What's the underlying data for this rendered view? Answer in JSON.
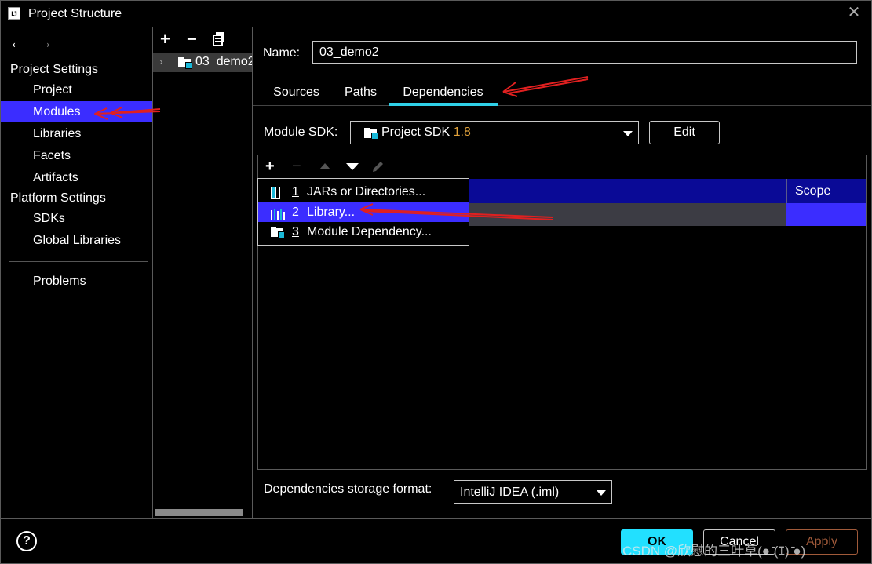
{
  "window": {
    "title": "Project Structure",
    "icon_text": "IJ"
  },
  "nav": {
    "back": "←",
    "forward": "→"
  },
  "sidebar": {
    "project_settings": "Project Settings",
    "items": [
      {
        "label": "Project"
      },
      {
        "label": "Modules"
      },
      {
        "label": "Libraries"
      },
      {
        "label": "Facets"
      },
      {
        "label": "Artifacts"
      }
    ],
    "platform_settings": "Platform Settings",
    "platform_items": [
      {
        "label": "SDKs"
      },
      {
        "label": "Global Libraries"
      }
    ],
    "problems": "Problems"
  },
  "tree": {
    "module": "03_demo2"
  },
  "name_field": {
    "label": "Name:",
    "value": "03_demo2"
  },
  "tabs": [
    {
      "label": "Sources"
    },
    {
      "label": "Paths"
    },
    {
      "label": "Dependencies"
    }
  ],
  "sdk": {
    "label": "Module SDK:",
    "value": "Project SDK",
    "version": "1.8",
    "edit": "Edit"
  },
  "dependencies": {
    "scope_header": "Scope"
  },
  "popup": [
    {
      "num": "1",
      "label": "JARs or Directories..."
    },
    {
      "num": "2",
      "label": "Library..."
    },
    {
      "num": "3",
      "label": "Module Dependency..."
    }
  ],
  "storage": {
    "label": "Dependencies storage format:",
    "value": "IntelliJ IDEA (.iml)"
  },
  "buttons": {
    "help": "?",
    "ok": "OK",
    "cancel": "Cancel",
    "apply": "Apply"
  },
  "watermark": "CSDN @欣慰的三叶草(● ̄(ｴ) ̄●)",
  "colors": {
    "selection": "#3b2dff",
    "accent": "#2fd0e8",
    "header": "#0a0a96",
    "arrow": "#e02020"
  }
}
